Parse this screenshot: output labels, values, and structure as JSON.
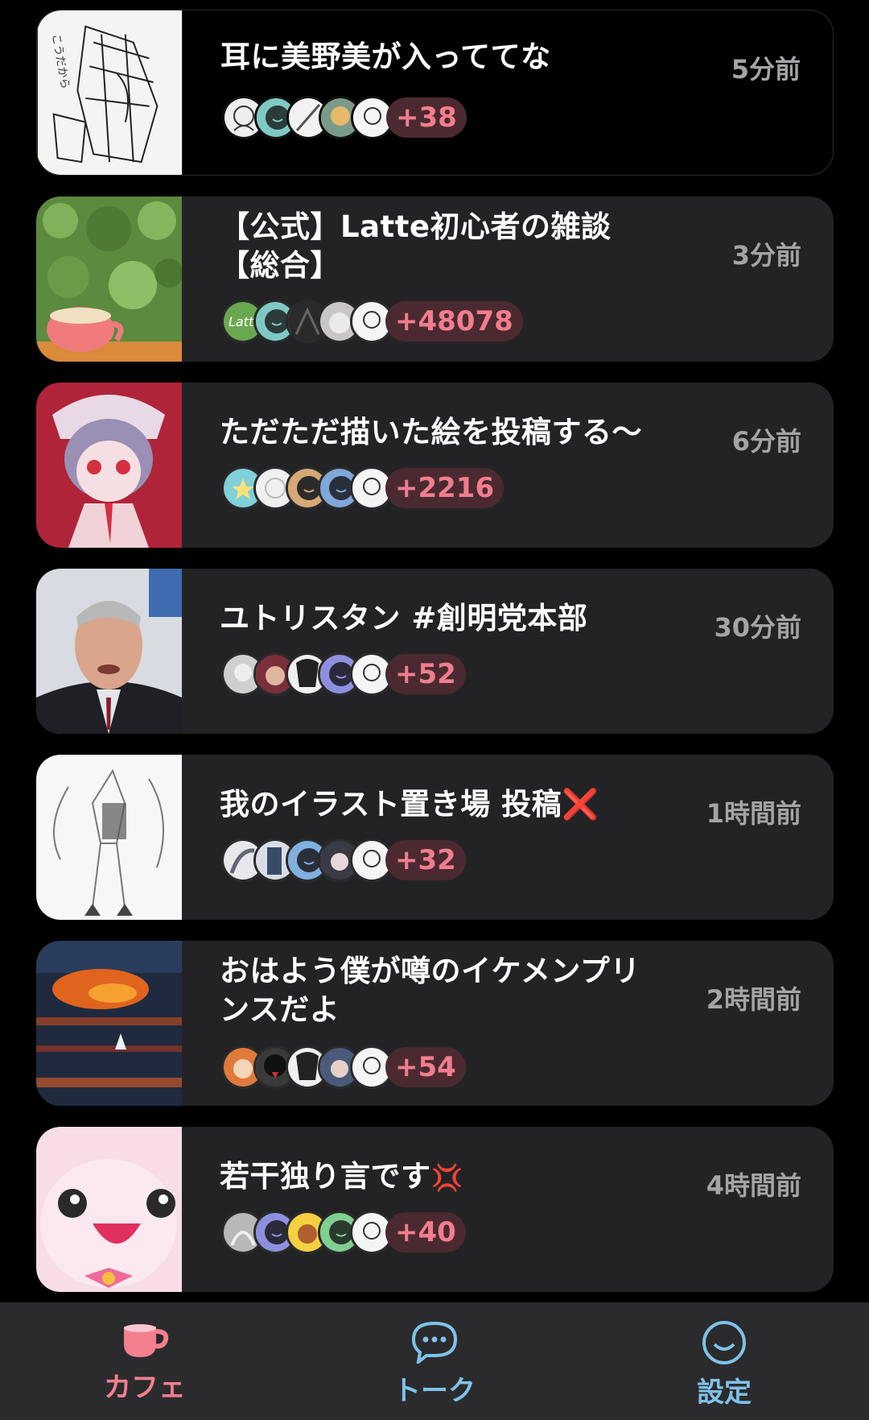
{
  "rooms": [
    {
      "title": "耳に美野美が入っててな",
      "time": "5分前",
      "count": "+38"
    },
    {
      "title": "【公式】Latte初心者の雑談【総合】",
      "time": "3分前",
      "count": "+48078"
    },
    {
      "title": "ただただ描いた絵を投稿する〜",
      "time": "6分前",
      "count": "+2216"
    },
    {
      "title": "ユトリスタン #創明党本部",
      "time": "30分前",
      "count": "+52"
    },
    {
      "title": "我のイラスト置き場 投稿",
      "title_emoji": "❌",
      "time": "1時間前",
      "count": "+32"
    },
    {
      "title": "おはよう僕が噂のイケメンプリンスだよ",
      "time": "2時間前",
      "count": "+54"
    },
    {
      "title": "若干独り言です",
      "title_emoji": "💢",
      "time": "4時間前",
      "count": "+40"
    }
  ],
  "nav": {
    "cafe": "カフェ",
    "talk": "トーク",
    "settings": "設定"
  },
  "colors": {
    "card_bg": "#232325",
    "count_text": "#f17d8d",
    "count_bg": "#4a2a30",
    "nav_cafe": "#f37f8f",
    "nav_talk": "#7fc2e8",
    "nav_settings": "#7fc2e8"
  }
}
